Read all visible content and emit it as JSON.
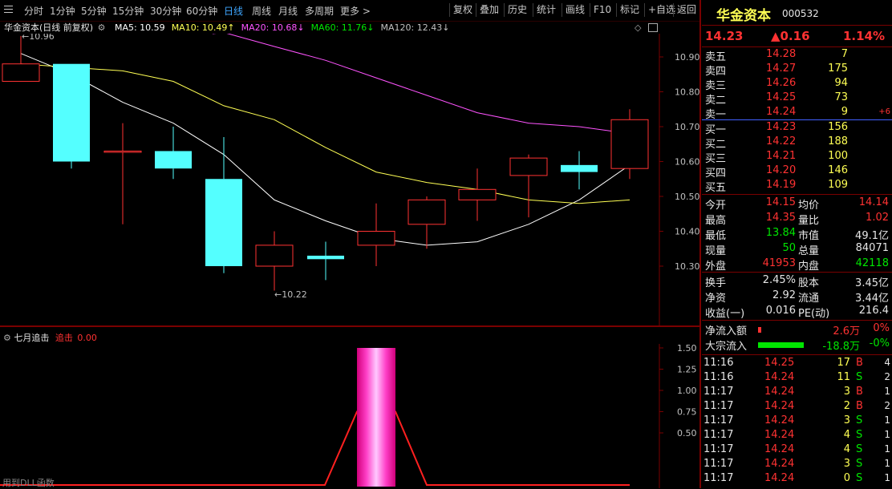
{
  "toolbar": {
    "periods": [
      "分时",
      "1分钟",
      "5分钟",
      "15分钟",
      "30分钟",
      "60分钟",
      "日线",
      "周线",
      "月线",
      "多周期",
      "更多 >"
    ],
    "active_period": "日线",
    "buttons": [
      "复权",
      "叠加",
      "历史",
      "统计",
      "画线",
      "F10",
      "标记",
      "+自选",
      "返回"
    ]
  },
  "chart_header": {
    "stock_label": "华金资本(日线 前复权)",
    "ma": [
      {
        "label": "MA5: 10.59",
        "color": "#ffffff"
      },
      {
        "label": "MA10: 10.49↑",
        "color": "#ffff54"
      },
      {
        "label": "MA20: 10.68↓",
        "color": "#ff54ff"
      },
      {
        "label": "MA60: 11.76↓",
        "color": "#00e600"
      },
      {
        "label": "MA120: 12.43↓",
        "color": "#c0c0c0"
      }
    ]
  },
  "chart_data": [
    {
      "type": "candlestick",
      "title": "华金资本(日线 前复权)",
      "y_ticks": [
        "10.90",
        "10.80",
        "10.70",
        "10.60",
        "10.50",
        "10.40",
        "10.30"
      ],
      "ylim": [
        10.22,
        10.98
      ],
      "max_annotation": "10.96",
      "min_annotation": "10.22",
      "candles": [
        {
          "o": 10.83,
          "h": 10.96,
          "l": 10.83,
          "c": 10.88
        },
        {
          "o": 10.88,
          "h": 10.88,
          "l": 10.58,
          "c": 10.6
        },
        {
          "o": 10.63,
          "h": 10.71,
          "l": 10.42,
          "c": 10.63
        },
        {
          "o": 10.63,
          "h": 10.7,
          "l": 10.55,
          "c": 10.58
        },
        {
          "o": 10.55,
          "h": 10.67,
          "l": 10.28,
          "c": 10.3
        },
        {
          "o": 10.3,
          "h": 10.4,
          "l": 10.23,
          "c": 10.36
        },
        {
          "o": 10.33,
          "h": 10.37,
          "l": 10.26,
          "c": 10.32
        },
        {
          "o": 10.36,
          "h": 10.48,
          "l": 10.3,
          "c": 10.4
        },
        {
          "o": 10.42,
          "h": 10.5,
          "l": 10.35,
          "c": 10.49
        },
        {
          "o": 10.49,
          "h": 10.58,
          "l": 10.43,
          "c": 10.52
        },
        {
          "o": 10.56,
          "h": 10.62,
          "l": 10.44,
          "c": 10.61
        },
        {
          "o": 10.59,
          "h": 10.63,
          "l": 10.52,
          "c": 10.57
        },
        {
          "o": 10.58,
          "h": 10.75,
          "l": 10.55,
          "c": 10.72
        }
      ],
      "series": [
        {
          "name": "MA5",
          "color": "#ffffff",
          "values": [
            10.91,
            10.85,
            10.77,
            10.71,
            10.62,
            10.49,
            10.43,
            10.38,
            10.36,
            10.37,
            10.42,
            10.49,
            10.59
          ]
        },
        {
          "name": "MA10",
          "color": "#ffff54",
          "values": [
            10.88,
            10.87,
            10.86,
            10.83,
            10.76,
            10.72,
            10.64,
            10.57,
            10.54,
            10.52,
            10.49,
            10.48,
            10.49
          ]
        },
        {
          "name": "MA20",
          "color": "#ff54ff",
          "values": [
            null,
            null,
            null,
            null,
            10.97,
            10.93,
            10.89,
            10.84,
            10.79,
            10.74,
            10.71,
            10.7,
            10.68
          ]
        }
      ]
    },
    {
      "type": "bar",
      "title": "七月追击",
      "indicator_name": "追击",
      "indicator_value": "0.00",
      "y_ticks": [
        "1.50",
        "1.25",
        "1.00",
        "0.75",
        "0.50"
      ],
      "ylim": [
        0,
        1.6
      ],
      "values": [
        0,
        0,
        0,
        0,
        0,
        0,
        0,
        1,
        0,
        0,
        0,
        0,
        0
      ],
      "footer": "用到DLL函数"
    }
  ],
  "quote": {
    "name": "华金资本",
    "code": "000532",
    "price": "14.23",
    "change": "▲0.16",
    "pct": "1.14%",
    "asks": [
      {
        "label": "卖五",
        "price": "14.28",
        "vol": "7",
        "extra": ""
      },
      {
        "label": "卖四",
        "price": "14.27",
        "vol": "175",
        "extra": ""
      },
      {
        "label": "卖三",
        "price": "14.26",
        "vol": "94",
        "extra": ""
      },
      {
        "label": "卖二",
        "price": "14.25",
        "vol": "73",
        "extra": ""
      },
      {
        "label": "卖一",
        "price": "14.24",
        "vol": "9",
        "extra": "+6"
      }
    ],
    "bids": [
      {
        "label": "买一",
        "price": "14.23",
        "vol": "156"
      },
      {
        "label": "买二",
        "price": "14.22",
        "vol": "188"
      },
      {
        "label": "买三",
        "price": "14.21",
        "vol": "100"
      },
      {
        "label": "买四",
        "price": "14.20",
        "vol": "146"
      },
      {
        "label": "买五",
        "price": "14.19",
        "vol": "109"
      }
    ],
    "stats": [
      {
        "l1": "今开",
        "v1": "14.15",
        "c1": "red",
        "l2": "均价",
        "v2": "14.14",
        "c2": "red"
      },
      {
        "l1": "最高",
        "v1": "14.35",
        "c1": "red",
        "l2": "量比",
        "v2": "1.02",
        "c2": "red"
      },
      {
        "l1": "最低",
        "v1": "13.84",
        "c1": "green",
        "l2": "市值",
        "v2": "49.1亿",
        "c2": "white"
      },
      {
        "l1": "现量",
        "v1": "50",
        "c1": "green",
        "l2": "总量",
        "v2": "84071",
        "c2": "white"
      },
      {
        "l1": "外盘",
        "v1": "41953",
        "c1": "red",
        "l2": "内盘",
        "v2": "42118",
        "c2": "green"
      }
    ],
    "fin": [
      {
        "l1": "换手",
        "v1": "2.45%",
        "l2": "股本",
        "v2": "3.45亿"
      },
      {
        "l1": "净资",
        "v1": "2.92",
        "l2": "流通",
        "v2": "3.44亿"
      },
      {
        "l1": "收益(一)",
        "v1": "0.016",
        "l2": "PE(动)",
        "v2": "216.4"
      }
    ],
    "flow": [
      {
        "label": "净流入额",
        "value": "2.6万",
        "pct": "0%",
        "color": "#ff3232",
        "bar": 0.04
      },
      {
        "label": "大宗流入",
        "value": "-18.8万",
        "pct": "-0%",
        "color": "#00e600",
        "bar": 1
      }
    ],
    "ticks": [
      {
        "time": "11:16",
        "price": "14.25",
        "vol": "17",
        "side": "B",
        "n": "4"
      },
      {
        "time": "11:16",
        "price": "14.24",
        "vol": "11",
        "side": "S",
        "n": "2"
      },
      {
        "time": "11:17",
        "price": "14.24",
        "vol": "3",
        "side": "B",
        "n": "1"
      },
      {
        "time": "11:17",
        "price": "14.24",
        "vol": "2",
        "side": "B",
        "n": "2"
      },
      {
        "time": "11:17",
        "price": "14.24",
        "vol": "3",
        "side": "S",
        "n": "1"
      },
      {
        "time": "11:17",
        "price": "14.24",
        "vol": "4",
        "side": "S",
        "n": "1"
      },
      {
        "time": "11:17",
        "price": "14.24",
        "vol": "4",
        "side": "S",
        "n": "1"
      },
      {
        "time": "11:17",
        "price": "14.24",
        "vol": "3",
        "side": "S",
        "n": "1"
      },
      {
        "time": "11:17",
        "price": "14.24",
        "vol": "0",
        "side": "S",
        "n": "1"
      }
    ]
  }
}
